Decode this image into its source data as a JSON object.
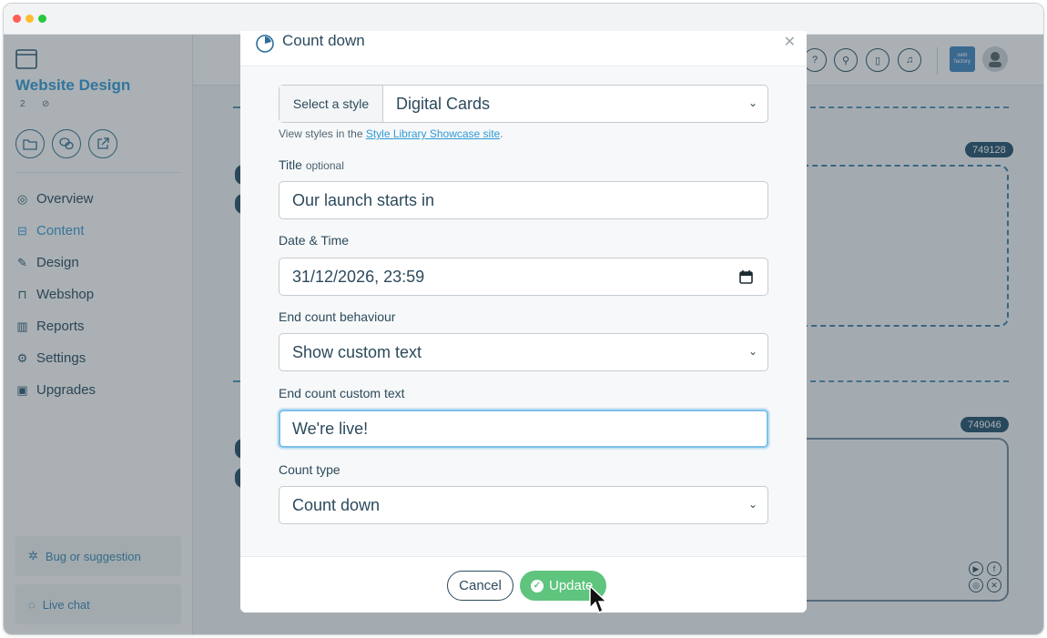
{
  "sidebar": {
    "title": "Website Design",
    "badge_count": "2",
    "nav": [
      {
        "label": "Overview",
        "icon": "compass-icon"
      },
      {
        "label": "Content",
        "icon": "content-tree-icon"
      },
      {
        "label": "Design",
        "icon": "pencil-ruler-icon"
      },
      {
        "label": "Webshop",
        "icon": "basket-icon"
      },
      {
        "label": "Reports",
        "icon": "bar-chart-icon"
      },
      {
        "label": "Settings",
        "icon": "gear-icon"
      },
      {
        "label": "Upgrades",
        "icon": "calendar-check-icon"
      }
    ],
    "bug_label": "Bug or suggestion",
    "chat_label": "Live chat"
  },
  "topbar": {
    "logo_text": "web factory"
  },
  "canvas": {
    "badge_1": "749128",
    "badge_2": "749046"
  },
  "modal": {
    "title": "Count down",
    "style_addon": "Select a style",
    "style_value": "Digital Cards",
    "help_prefix": "View styles in the ",
    "help_link": "Style Library Showcase site",
    "help_suffix": ".",
    "title_label": "Title",
    "title_optional": "optional",
    "title_value": "Our launch starts in",
    "datetime_label": "Date & Time",
    "datetime_value": "31/12/2026, 23:59",
    "end_behaviour_label": "End count behaviour",
    "end_behaviour_value": "Show custom text",
    "end_text_label": "End count custom text",
    "end_text_value": "We're live!",
    "count_type_label": "Count type",
    "count_type_value": "Count down",
    "cancel_label": "Cancel",
    "update_label": "Update"
  },
  "colors": {
    "accent": "#2f9ad6",
    "update_green": "#5ec47e",
    "text_dark": "#2c4a5c"
  }
}
